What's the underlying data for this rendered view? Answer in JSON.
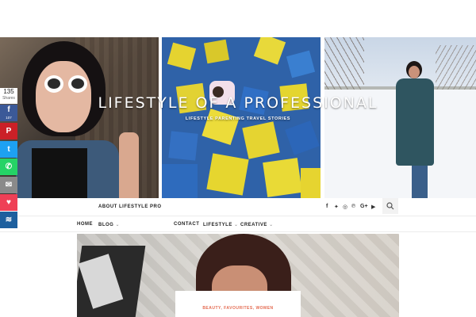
{
  "site": {
    "title": "LIFESTYLE OF A PROFESSIONAL",
    "tagline": "LIFESTYLE PARENTING TRAVEL STORIES"
  },
  "top_nav": {
    "about_label": "ABOUT LIFESTYLE PRO",
    "social_icons": [
      "facebook-icon",
      "twitter-icon",
      "instagram-icon",
      "pinterest-icon",
      "google-plus-icon",
      "youtube-icon"
    ]
  },
  "main_nav": {
    "items": [
      {
        "label": "HOME",
        "has_dropdown": false
      },
      {
        "label": "BLOG",
        "has_dropdown": true
      },
      {
        "label": "CONTACT",
        "has_dropdown": false
      },
      {
        "label": "LIFESTYLE",
        "has_dropdown": true
      },
      {
        "label": "CREATIVE",
        "has_dropdown": true
      }
    ],
    "dropdown_glyph": "⌄"
  },
  "share_bar": {
    "count": "135",
    "count_label": "Shares",
    "facebook_count": "107",
    "buttons": [
      {
        "icon": "facebook-icon",
        "color": "#3b5998",
        "glyph": "f"
      },
      {
        "icon": "pinterest-icon",
        "color": "#cb2027",
        "glyph": "P"
      },
      {
        "icon": "twitter-icon",
        "color": "#1da1f2",
        "glyph": "t"
      },
      {
        "icon": "whatsapp-icon",
        "color": "#25d366",
        "glyph": "✆"
      },
      {
        "icon": "email-icon",
        "color": "#8a8a8a",
        "glyph": "✉"
      },
      {
        "icon": "pocket-icon",
        "color": "#ef4056",
        "glyph": "♥"
      },
      {
        "icon": "sumo-icon",
        "color": "#1d5f9e",
        "glyph": "≋"
      }
    ]
  },
  "post": {
    "categories": "BEAUTY, FAVOURITES, WOMEN"
  }
}
